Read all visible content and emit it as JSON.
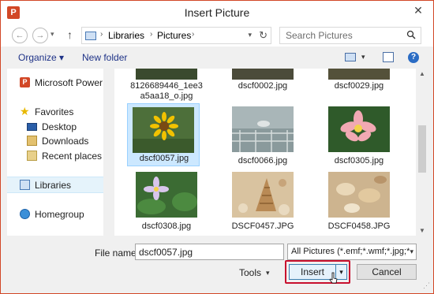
{
  "window": {
    "title": "Insert Picture",
    "app_icon_letter": "P"
  },
  "nav": {
    "breadcrumbs": [
      "Libraries",
      "Pictures"
    ],
    "search_placeholder": "Search Pictures"
  },
  "toolbar": {
    "organize_label": "Organize",
    "new_folder_label": "New folder"
  },
  "sidebar": {
    "items": [
      {
        "label": "Microsoft PowerPoint",
        "icon": "powerpoint-icon"
      },
      {
        "label": "Favorites",
        "icon": "star-icon"
      },
      {
        "label": "Desktop",
        "icon": "desktop-icon"
      },
      {
        "label": "Downloads",
        "icon": "downloads-icon"
      },
      {
        "label": "Recent places",
        "icon": "recent-places-icon"
      },
      {
        "label": "Libraries",
        "icon": "libraries-icon"
      },
      {
        "label": "Homegroup",
        "icon": "homegroup-icon"
      }
    ]
  },
  "files": [
    {
      "name": "8126689446_1ee3a5aa18_o.jpg",
      "line1": "8126689446_1ee3",
      "line2": "a5aa18_o.jpg"
    },
    {
      "name": "dscf0002.jpg"
    },
    {
      "name": "dscf0029.jpg"
    },
    {
      "name": "dscf0057.jpg",
      "selected": true
    },
    {
      "name": "dscf0066.jpg"
    },
    {
      "name": "dscf0305.jpg"
    },
    {
      "name": "dscf0308.jpg"
    },
    {
      "name": "DSCF0457.JPG"
    },
    {
      "name": "DSCF0458.JPG"
    }
  ],
  "bottom": {
    "file_name_label": "File name:",
    "file_name_value": "dscf0057.jpg",
    "filter_value": "All Pictures (*.emf;*.wmf;*.jpg;*",
    "tools_label": "Tools",
    "insert_label": "Insert",
    "cancel_label": "Cancel"
  },
  "colors": {
    "accent": "#d24726",
    "highlight": "#c8102e",
    "link": "#1e3287",
    "selection": "#cce8ff"
  }
}
